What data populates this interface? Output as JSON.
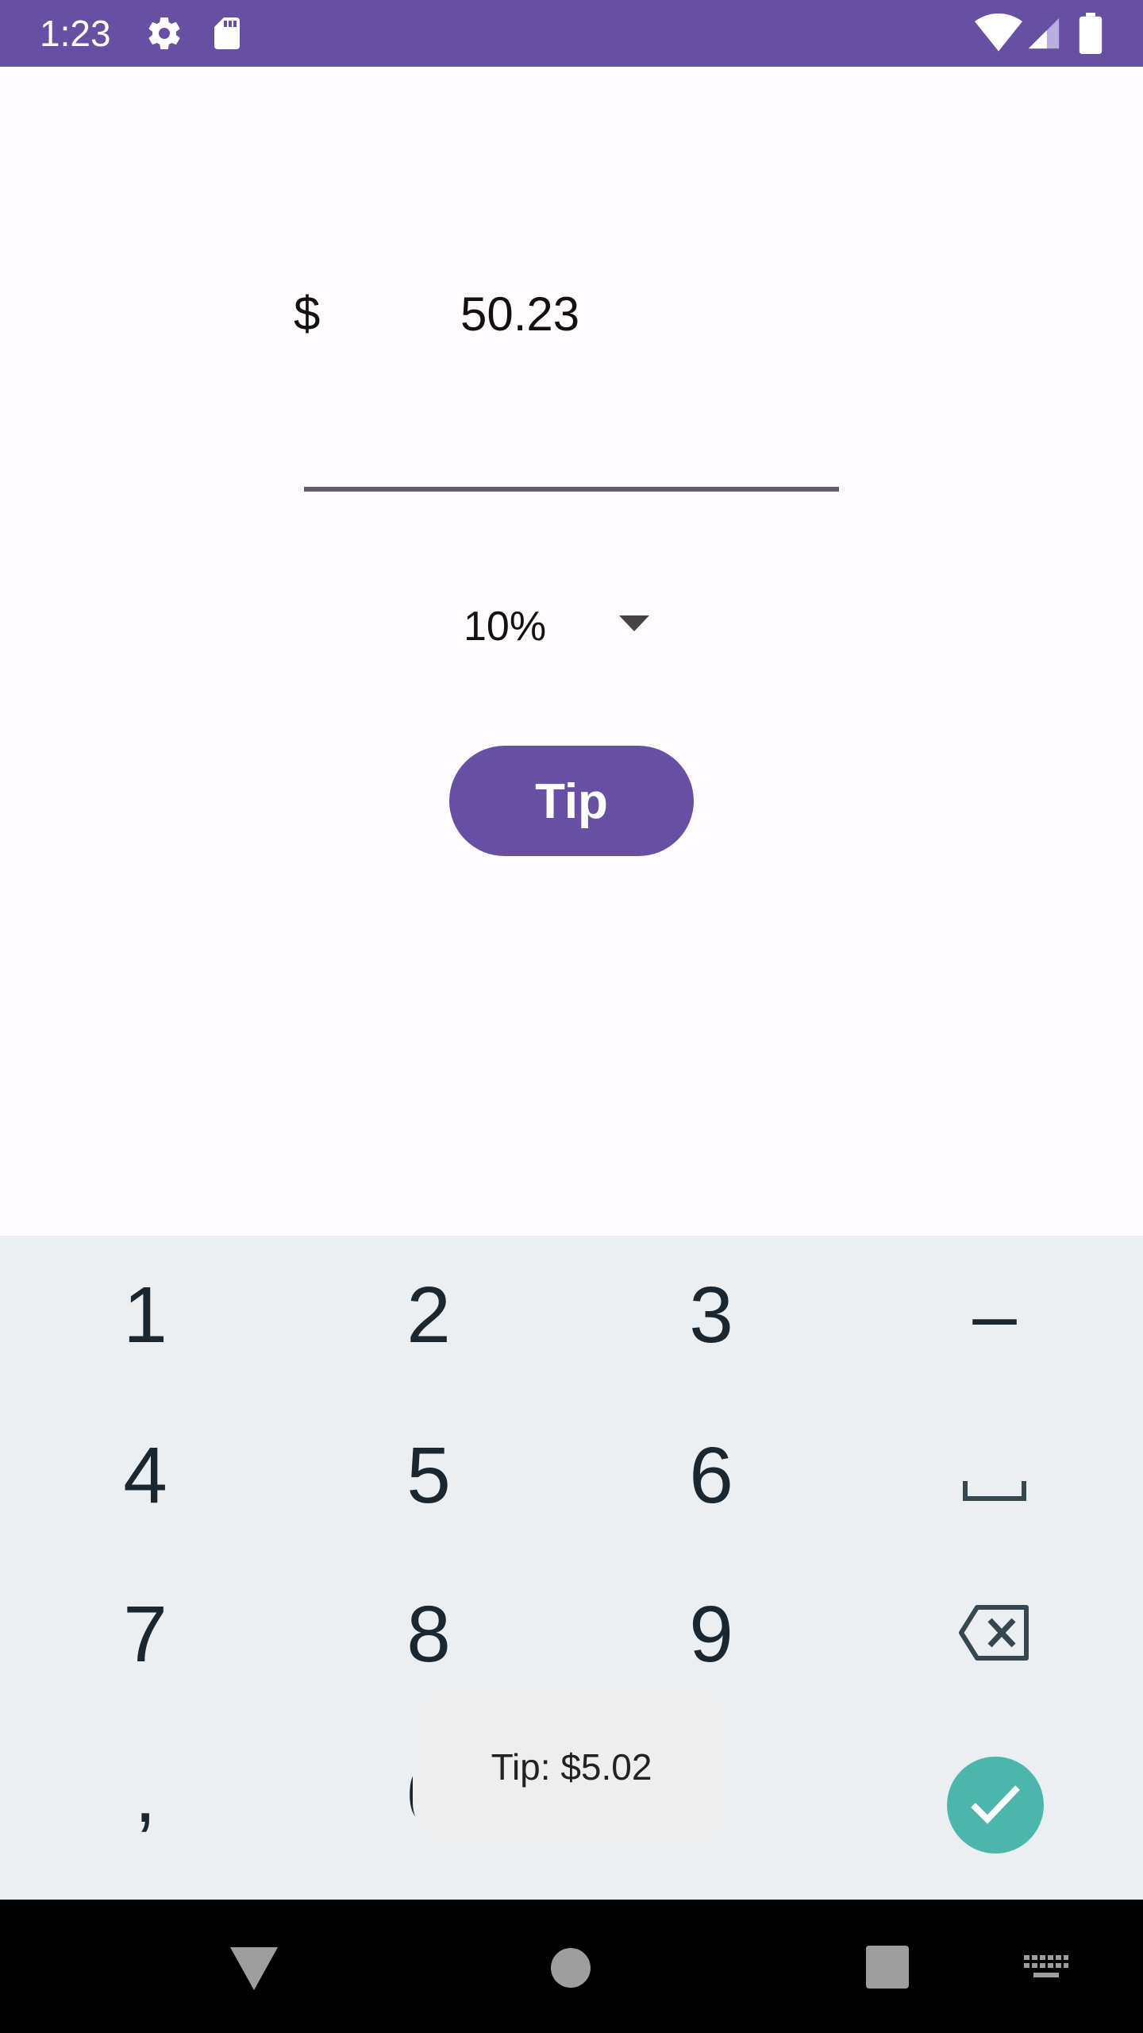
{
  "status_bar": {
    "time": "1:23",
    "icons": [
      "gear-icon",
      "sd-card-icon",
      "wifi-icon",
      "signal-icon",
      "battery-icon"
    ]
  },
  "tip_calculator": {
    "currency_symbol": "$",
    "bill_amount": "50.23",
    "tip_percent_selected": "10%",
    "tip_button_label": "Tip"
  },
  "keyboard": {
    "rows": [
      [
        "1",
        "2",
        "3",
        "–"
      ],
      [
        "4",
        "5",
        "6",
        "space"
      ],
      [
        "7",
        "8",
        "9",
        "backspace"
      ],
      [
        ",",
        "0",
        ".",
        "done"
      ]
    ],
    "key_labels": {
      "k1": "1",
      "k2": "2",
      "k3": "3",
      "minus": "–",
      "k4": "4",
      "k5": "5",
      "k6": "6",
      "k7": "7",
      "k8": "8",
      "k9": "9",
      "comma": ",",
      "k0": "0",
      "period": "."
    }
  },
  "toast": {
    "message": "Tip: $5.02"
  },
  "colors": {
    "primary": "#6750a4",
    "keyboard_background": "#eceff1",
    "done_key": "#4db6ac",
    "key_text": "#1a2630"
  },
  "nav_bar": {
    "buttons": [
      "back-icon",
      "home-icon",
      "recents-icon",
      "keyboard-switch-icon"
    ]
  }
}
